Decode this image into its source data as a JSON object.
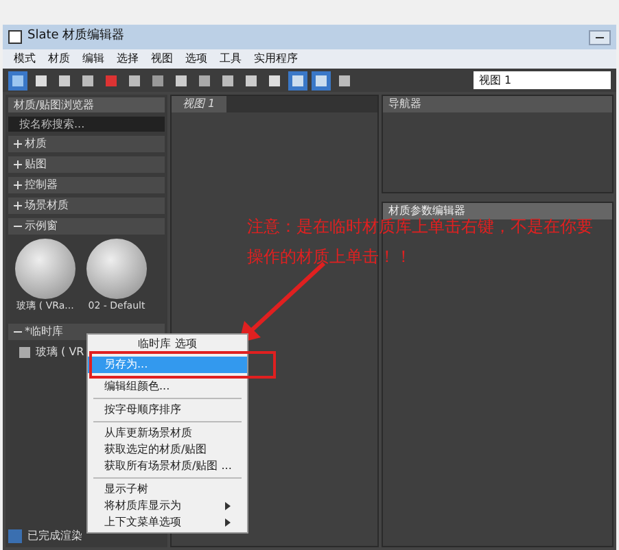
{
  "window": {
    "title": "Slate 材质编辑器"
  },
  "menubar": [
    "模式",
    "材质",
    "编辑",
    "选择",
    "视图",
    "选项",
    "工具",
    "实用程序"
  ],
  "toolbar": {
    "view_dropdown": "视图 1"
  },
  "browser": {
    "title": "材质/贴图浏览器",
    "search_placeholder": "按名称搜索...",
    "groups": [
      {
        "label": "材质",
        "expanded": false
      },
      {
        "label": "贴图",
        "expanded": false
      },
      {
        "label": "控制器",
        "expanded": false
      },
      {
        "label": "场景材质",
        "expanded": false
      }
    ],
    "sample_slots": {
      "label": "示例窗",
      "expanded": true,
      "items": [
        "玻璃 ( VRa...",
        "02 - Default"
      ]
    },
    "library": {
      "label": "*临时库",
      "expanded": true,
      "items": [
        "玻璃 ( VR"
      ]
    }
  },
  "view_tab": "视图 1",
  "navigator": {
    "title": "导航器"
  },
  "param_editor": {
    "title": "材质参数编辑器"
  },
  "context_menu": {
    "header": "临时库 选项",
    "items": [
      {
        "kind": "item",
        "label": "另存为...",
        "selected": true,
        "submenu": false
      },
      {
        "kind": "item",
        "label": "编辑组颜色...",
        "selected": false,
        "submenu": false
      },
      {
        "kind": "separator"
      },
      {
        "kind": "item",
        "label": "按字母顺序排序",
        "selected": false,
        "submenu": false
      },
      {
        "kind": "separator"
      },
      {
        "kind": "item",
        "label": "从库更新场景材质",
        "selected": false,
        "submenu": false
      },
      {
        "kind": "item",
        "label": "获取选定的材质/贴图",
        "selected": false,
        "submenu": false
      },
      {
        "kind": "item",
        "label": "获取所有场景材质/贴图 ...",
        "selected": false,
        "submenu": false
      },
      {
        "kind": "separator"
      },
      {
        "kind": "item",
        "label": "显示子树",
        "selected": false,
        "submenu": false
      },
      {
        "kind": "item",
        "label": "将材质库显示为",
        "selected": false,
        "submenu": true
      },
      {
        "kind": "item",
        "label": "上下文菜单选项",
        "selected": false,
        "submenu": true
      }
    ]
  },
  "annotation": [
    "注意：是在临时材质库上单击右键，不是在你要",
    "操作的材质上单击！！"
  ],
  "status_bar": "已完成渲染"
}
